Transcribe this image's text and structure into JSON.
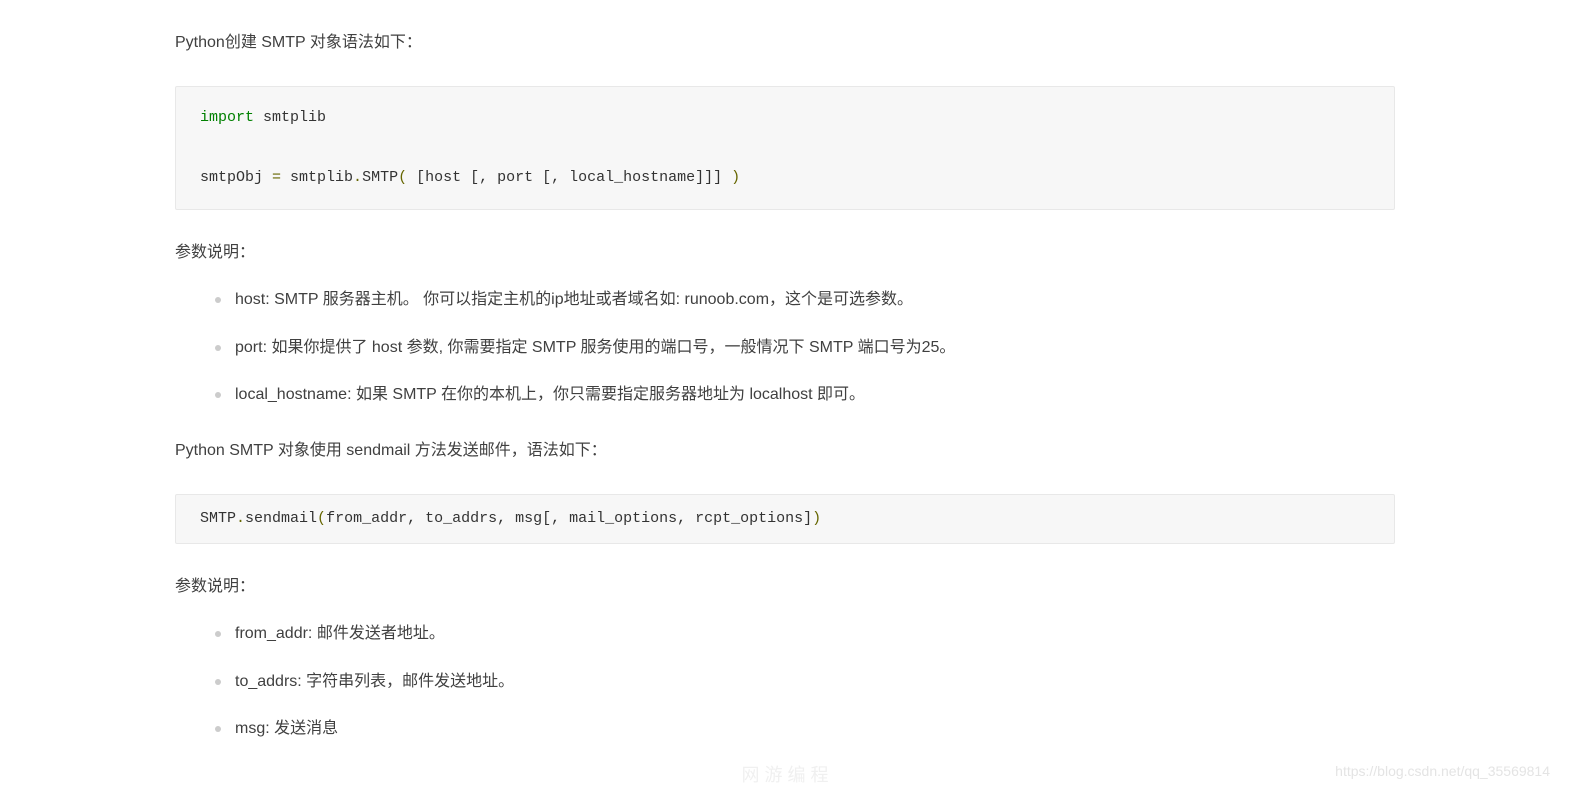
{
  "intro": "Python创建 SMTP 对象语法如下：",
  "code1": {
    "kw": "import",
    "mod": " smtplib",
    "line2a": "smtpObj ",
    "eq": "=",
    "line2b": " smtplib",
    "dot": ".",
    "cls": "SMTP",
    "lp": "(",
    "args": " [host [, port [, local_hostname]]] ",
    "rp": ")"
  },
  "params_label1": "参数说明：",
  "params1": [
    "host: SMTP 服务器主机。 你可以指定主机的ip地址或者域名如: runoob.com，这个是可选参数。",
    "port: 如果你提供了 host 参数, 你需要指定 SMTP 服务使用的端口号，一般情况下 SMTP 端口号为25。",
    "local_hostname: 如果 SMTP 在你的本机上，你只需要指定服务器地址为 localhost 即可。"
  ],
  "sendmail_intro": "Python SMTP 对象使用 sendmail 方法发送邮件，语法如下：",
  "code2": {
    "a": "SMTP",
    "dot": ".",
    "b": "sendmail",
    "lp": "(",
    "args": "from_addr, to_addrs, msg[, mail_options, rcpt_options]",
    "rp": ")"
  },
  "params_label2": "参数说明：",
  "params2": [
    "from_addr: 邮件发送者地址。",
    "to_addrs: 字符串列表，邮件发送地址。",
    "msg: 发送消息"
  ],
  "watermark": "https://blog.csdn.net/qq_35569814",
  "footer_faded": "网 游 编 程"
}
